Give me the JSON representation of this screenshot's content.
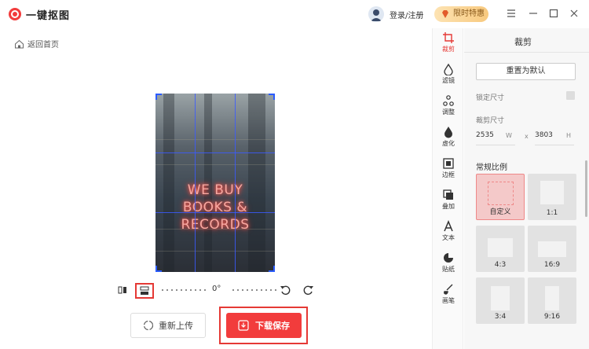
{
  "app": {
    "title": "一键抠图"
  },
  "header": {
    "login_label": "登录/注册",
    "vip_label": "限时特惠"
  },
  "nav": {
    "back_label": "返回首页"
  },
  "image": {
    "neon_lines": [
      "WE BUY",
      "BOOKS &",
      "RECORDS"
    ]
  },
  "rotate": {
    "angle_label": "0°"
  },
  "actions": {
    "reupload_label": "重新上传",
    "download_label": "下载保存"
  },
  "tools": [
    {
      "label": "裁剪",
      "icon": "crop-icon",
      "active": true
    },
    {
      "label": "滤镜",
      "icon": "filter-icon"
    },
    {
      "label": "调整",
      "icon": "adjust-icon"
    },
    {
      "label": "虚化",
      "icon": "blur-icon"
    },
    {
      "label": "边框",
      "icon": "border-icon"
    },
    {
      "label": "叠加",
      "icon": "overlay-icon"
    },
    {
      "label": "文本",
      "icon": "text-icon"
    },
    {
      "label": "贴纸",
      "icon": "sticker-icon"
    },
    {
      "label": "画笔",
      "icon": "brush-icon"
    }
  ],
  "panel": {
    "title": "裁剪",
    "reset_label": "重置为默认",
    "lock_label": "锁定尺寸",
    "size_label": "裁剪尺寸",
    "width": "2535",
    "width_unit": "W",
    "times": "x",
    "height": "3803",
    "height_unit": "H",
    "ratio_section": "常规比例",
    "ratios": [
      {
        "label": "自定义",
        "selected": true
      },
      {
        "label": "1:1"
      },
      {
        "label": "4:3"
      },
      {
        "label": "16:9"
      },
      {
        "label": "3:4"
      },
      {
        "label": "9:16"
      }
    ]
  },
  "colors": {
    "accent": "#e53935",
    "button_red": "#f23c3c",
    "grid_blue": "#3b5bff"
  }
}
